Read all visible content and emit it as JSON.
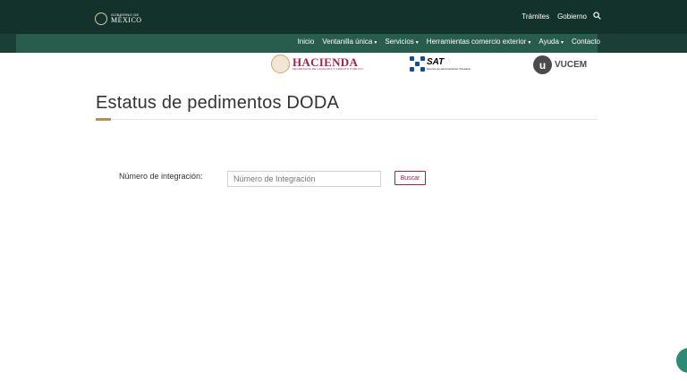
{
  "header": {
    "gov_small": "GOBIERNO DE",
    "gov_big": "MÉXICO",
    "links": [
      "Trámites",
      "Gobierno"
    ],
    "search_icon": "search-icon"
  },
  "nav": {
    "items": [
      {
        "label": "Inicio",
        "dropdown": false
      },
      {
        "label": "Ventanilla única",
        "dropdown": true
      },
      {
        "label": "Servicios",
        "dropdown": true
      },
      {
        "label": "Herramientas comercio exterior",
        "dropdown": true
      },
      {
        "label": "Ayuda",
        "dropdown": true
      },
      {
        "label": "Contacto",
        "dropdown": false
      }
    ],
    "caret": "▾"
  },
  "logos": {
    "hacienda_title": "HACIENDA",
    "hacienda_sub": "SECRETARÍA DE HACIENDA Y CRÉDITO PÚBLICO",
    "sat_title": "SAT",
    "sat_sub": "Servicio de Administración Tributaria",
    "vucem_letter": "u",
    "vucem_title": "VUCEM"
  },
  "page": {
    "title": "Estatus de pedimentos DODA"
  },
  "form": {
    "label": "Número de integración:",
    "placeholder": "Número de Integración",
    "value": "",
    "button": "Buscar"
  },
  "colors": {
    "header_bg": "#13322b",
    "nav_bg": "#285c4d",
    "accent_gold": "#b38e5d",
    "accent_wine": "#9d2449",
    "chat_bubble": "#2e8b73"
  }
}
